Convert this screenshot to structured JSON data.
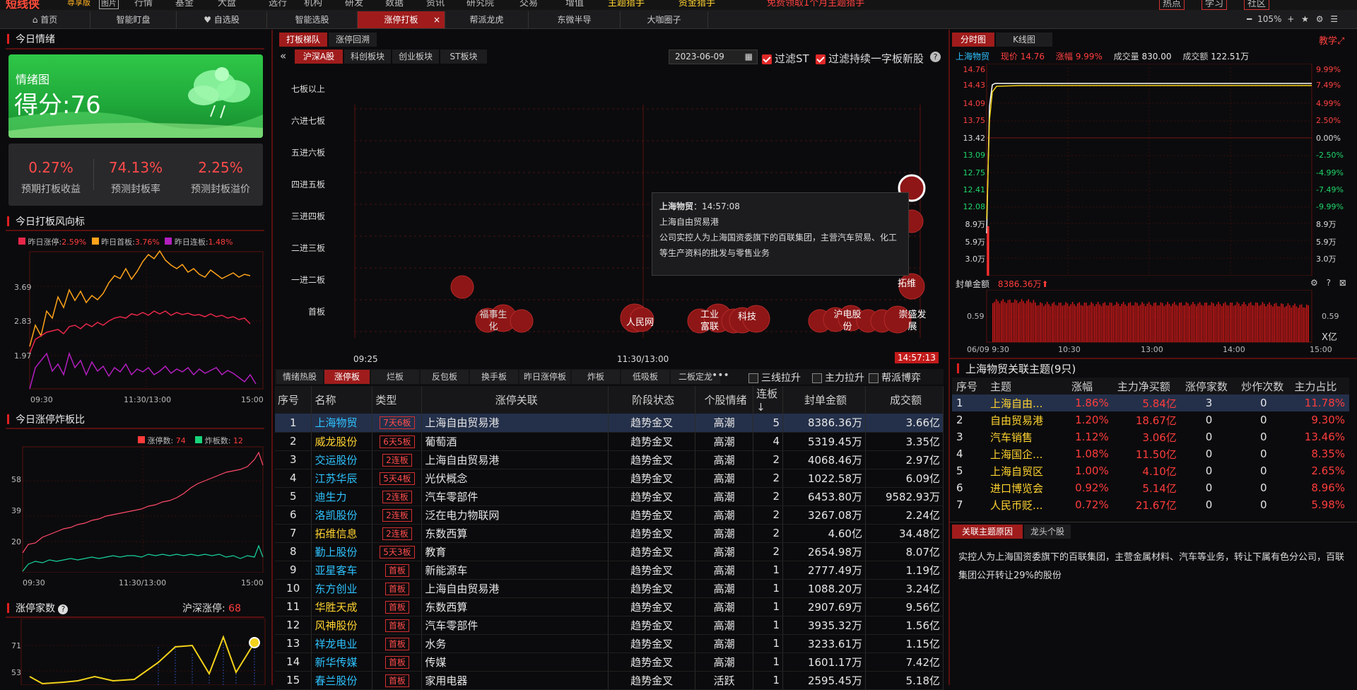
{
  "menu": {
    "logo": "短线侠",
    "edition": "尊享版",
    "icon": "图片",
    "items": [
      "行情",
      "基金",
      "大盘",
      "选行",
      "机构",
      "研发",
      "数据",
      "资讯",
      "研究院",
      "交易",
      "增值",
      "主题猎手",
      "资金猎手"
    ],
    "promo": "免费领取1个月主题猎手",
    "right": [
      "热点",
      "学习",
      "社区"
    ]
  },
  "tabs": [
    "首页",
    "智能盯盘",
    "自选股",
    "智能选股",
    "涨停打板",
    "帮派龙虎",
    "东微半导",
    "大咖圈子"
  ],
  "zoom": "105%",
  "left": {
    "mood_title": "今日情绪",
    "mood_label": "情绪图",
    "mood_score": "得分:76",
    "stats": [
      {
        "value": "0.27%",
        "label": "预期打板收益"
      },
      {
        "value": "74.13%",
        "label": "预测封板率"
      },
      {
        "value": "2.25%",
        "label": "预测封板溢价"
      }
    ],
    "wind_title": "今日打板风向标",
    "wind_legend": [
      {
        "name": "昨日涨停:",
        "value": "2.59%",
        "color": "#e8274a"
      },
      {
        "name": "昨日首板:",
        "value": "3.76%",
        "color": "#ffa31a"
      },
      {
        "name": "昨日连板:",
        "value": "1.48%",
        "color": "#b21ebf"
      }
    ],
    "wind_yticks": [
      "3.69",
      "2.83",
      "1.97"
    ],
    "wind_xticks": [
      "09:30",
      "11:30/13:00",
      "15:00"
    ],
    "zt_title": "今日涨停炸板比",
    "zt_legend": [
      {
        "name": "涨停数:",
        "value": "74",
        "color": "#ff3b3b"
      },
      {
        "name": "炸板数:",
        "value": "12",
        "color": "#17d37a"
      }
    ],
    "zt_yticks": [
      "58",
      "39",
      "20"
    ],
    "zt_xticks": [
      "09:30",
      "11:30/13:00",
      "15:00"
    ],
    "count_title": "涨停家数",
    "count_hs_label": "沪深涨停:",
    "count_hs_value": "68",
    "count_yticks": [
      "71",
      "53"
    ]
  },
  "mid": {
    "top_tabs": [
      "打板梯队",
      "涨停回溯"
    ],
    "market_tabs": [
      "沪深A股",
      "科创板块",
      "创业板块",
      "ST板块"
    ],
    "date": "2023-06-09",
    "filter1": "过滤ST",
    "filter2": "过滤持续一字板新股",
    "levels": [
      "七板以上",
      "六进七板",
      "五进六板",
      "四进五板",
      "三进四板",
      "二进三板",
      "一进二板",
      "首板"
    ],
    "bubble_labels": [
      "福事生化",
      "人民网",
      "工业富联",
      "科技",
      "沪电股份",
      "崇盛发展",
      "拓维"
    ],
    "x_start": "09:25",
    "x_mid": "11:30/13:00",
    "x_end": "14:57:13",
    "tooltip": {
      "name": "上海物贸",
      "time": "14:57:08",
      "theme": "上海自由贸易港",
      "desc": "公司实控人为上海国资委旗下的百联集团，主营汽车贸易、化工等生产资料的批发与零售业务"
    },
    "bottom_tabs": [
      "情绪热股",
      "涨停板",
      "烂板",
      "反包板",
      "换手板",
      "昨日涨停板",
      "炸板",
      "低吸板",
      "二板定龙"
    ],
    "toggles": [
      "三线拉升",
      "主力拉升",
      "帮派博弈"
    ],
    "columns": [
      "序号",
      "名称",
      "类型",
      "涨停关联",
      "阶段状态",
      "个股情绪",
      "连板↓",
      "封单金额",
      "成交额"
    ],
    "rows": [
      [
        "1",
        "上海物贸",
        "7天6板",
        "上海自由贸易港",
        "趋势金叉",
        "高潮",
        "5",
        "8386.36万",
        "3.66亿"
      ],
      [
        "2",
        "威龙股份",
        "6天5板",
        "葡萄酒",
        "趋势金叉",
        "高潮",
        "4",
        "5319.45万",
        "3.35亿"
      ],
      [
        "3",
        "交运股份",
        "2连板",
        "上海自由贸易港",
        "趋势金叉",
        "高潮",
        "2",
        "4068.46万",
        "2.97亿"
      ],
      [
        "4",
        "江苏华辰",
        "5天4板",
        "光伏概念",
        "趋势金叉",
        "高潮",
        "2",
        "1022.58万",
        "6.09亿"
      ],
      [
        "5",
        "迪生力",
        "2连板",
        "汽车零部件",
        "趋势金叉",
        "高潮",
        "2",
        "6453.80万",
        "9582.93万"
      ],
      [
        "6",
        "洛凯股份",
        "2连板",
        "泛在电力物联网",
        "趋势金叉",
        "高潮",
        "2",
        "3267.08万",
        "2.24亿"
      ],
      [
        "7",
        "拓维信息",
        "2连板",
        "东数西算",
        "趋势金叉",
        "高潮",
        "2",
        "4.60亿",
        "34.48亿"
      ],
      [
        "8",
        "勤上股份",
        "5天3板",
        "教育",
        "趋势金叉",
        "高潮",
        "2",
        "2654.98万",
        "8.07亿"
      ],
      [
        "9",
        "亚星客车",
        "首板",
        "新能源车",
        "趋势金叉",
        "高潮",
        "1",
        "2777.49万",
        "1.19亿"
      ],
      [
        "10",
        "东方创业",
        "首板",
        "上海自由贸易港",
        "趋势金叉",
        "高潮",
        "1",
        "1088.20万",
        "3.24亿"
      ],
      [
        "11",
        "华胜天成",
        "首板",
        "东数西算",
        "趋势金叉",
        "高潮",
        "1",
        "2907.69万",
        "9.56亿"
      ],
      [
        "12",
        "风神股份",
        "首板",
        "汽车零部件",
        "趋势金叉",
        "高潮",
        "1",
        "3935.32万",
        "1.56亿"
      ],
      [
        "13",
        "祥龙电业",
        "首板",
        "水务",
        "趋势金叉",
        "高潮",
        "1",
        "3233.61万",
        "1.15亿"
      ],
      [
        "14",
        "新华传媒",
        "首板",
        "传媒",
        "趋势金叉",
        "高潮",
        "1",
        "1601.17万",
        "7.42亿"
      ],
      [
        "15",
        "春兰股份",
        "首板",
        "家用电器",
        "趋势金叉",
        "活跃",
        "1",
        "2595.45万",
        "5.18亿"
      ]
    ]
  },
  "right": {
    "chart_tabs": [
      "分时图",
      "K线图"
    ],
    "teach": "教学",
    "quote": {
      "name": "上海物贸",
      "price_label": "现价",
      "price": "14.76",
      "chg_label": "涨幅",
      "chg": "9.99%",
      "vol_label": "成交量",
      "vol": "830.00",
      "amt_label": "成交额",
      "amt": "122.51万"
    },
    "price_ticks": [
      "14.76",
      "14.43",
      "14.09",
      "13.75",
      "13.42",
      "13.09",
      "12.75",
      "12.41",
      "12.08",
      "8.9万",
      "5.9万",
      "3.0万"
    ],
    "pct_ticks": [
      "9.99%",
      "7.49%",
      "4.99%",
      "2.50%",
      "0.00%",
      "-2.50%",
      "-4.99%",
      "-7.49%",
      "-9.99%",
      "8.9万",
      "5.9万",
      "3.0万"
    ],
    "seal_label": "封单金额",
    "seal_value": "8386.36万",
    "seal_tick": "0.59",
    "seal_unit": "X亿",
    "time_ticks": [
      "06/09 9:30",
      "10:30",
      "13:00",
      "14:00",
      "15:00"
    ],
    "theme_title": "上海物贸关联主题(9只)",
    "theme_cols": [
      "序号",
      "主题",
      "涨幅",
      "主力净买额",
      "涨停家数",
      "炒作次数",
      "主力占比"
    ],
    "theme_rows": [
      [
        "1",
        "上海自由...",
        "1.86%",
        "5.84亿",
        "3",
        "0",
        "11.78%"
      ],
      [
        "2",
        "自由贸易港",
        "1.20%",
        "18.67亿",
        "0",
        "0",
        "9.30%"
      ],
      [
        "3",
        "汽车销售",
        "1.12%",
        "3.06亿",
        "0",
        "0",
        "13.46%"
      ],
      [
        "4",
        "上海国企...",
        "1.08%",
        "11.50亿",
        "0",
        "0",
        "8.35%"
      ],
      [
        "5",
        "上海自贸区",
        "1.00%",
        "4.10亿",
        "0",
        "0",
        "2.65%"
      ],
      [
        "6",
        "进口博览会",
        "0.92%",
        "5.14亿",
        "0",
        "0",
        "8.96%"
      ],
      [
        "7",
        "人民币贬...",
        "0.72%",
        "21.67亿",
        "0",
        "0",
        "5.98%"
      ]
    ],
    "reason_tabs": [
      "关联主题原因",
      "龙头个股"
    ],
    "reason_text": "实控人为上海国资委旗下的百联集团，主营金属材料、汽车等业务，转让下属有色分公司，百联集团公开转让29%的股份"
  },
  "colors": {
    "accent": "#e02020",
    "up": "#ff3c3c",
    "down": "#1fd66b",
    "stock": "#2ec3ff"
  }
}
